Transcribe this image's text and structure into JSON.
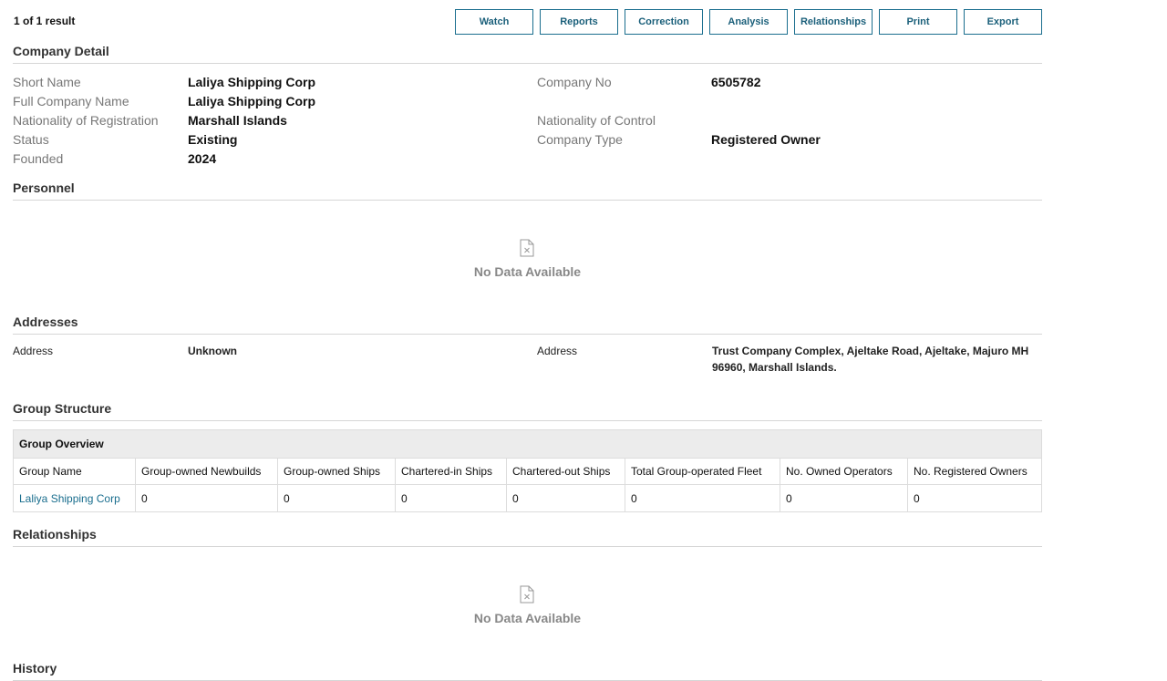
{
  "header": {
    "result_count": "1 of 1 result",
    "buttons": [
      "Watch",
      "Reports",
      "Correction",
      "Analysis",
      "Relationships",
      "Print",
      "Export"
    ]
  },
  "company_detail": {
    "title": "Company Detail",
    "short_name_label": "Short Name",
    "short_name": "Laliya Shipping Corp",
    "full_name_label": "Full Company Name",
    "full_name": "Laliya Shipping Corp",
    "nat_reg_label": "Nationality of Registration",
    "nat_reg": "Marshall Islands",
    "status_label": "Status",
    "status": "Existing",
    "founded_label": "Founded",
    "founded": "2024",
    "company_no_label": "Company No",
    "company_no": "6505782",
    "nat_control_label": "Nationality of Control",
    "nat_control": "",
    "company_type_label": "Company Type",
    "company_type": "Registered Owner"
  },
  "personnel": {
    "title": "Personnel",
    "empty_message": "No Data Available"
  },
  "addresses": {
    "title": "Addresses",
    "left_label": "Address",
    "left_value": "Unknown",
    "right_label": "Address",
    "right_value_line1": "Trust Company Complex, Ajeltake Road, Ajeltake, Majuro MH",
    "right_value_line2": "96960, Marshall Islands."
  },
  "group_structure": {
    "title": "Group Structure",
    "overview_title": "Group Overview",
    "columns": [
      "Group Name",
      "Group-owned Newbuilds",
      "Group-owned Ships",
      "Chartered-in Ships",
      "Chartered-out Ships",
      "Total Group-operated Fleet",
      "No. Owned Operators",
      "No. Registered Owners"
    ],
    "rows": [
      [
        "Laliya Shipping Corp",
        "0",
        "0",
        "0",
        "0",
        "0",
        "0",
        "0"
      ]
    ]
  },
  "relationships": {
    "title": "Relationships",
    "empty_message": "No Data Available"
  },
  "history": {
    "title": "History"
  }
}
